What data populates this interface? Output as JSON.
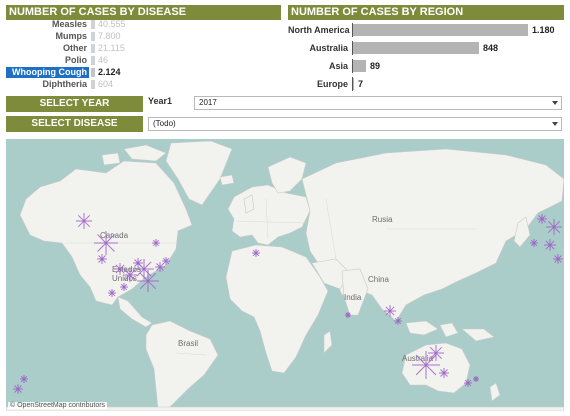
{
  "disease_panel": {
    "title": "NUMBER OF CASES BY DISEASE",
    "items": [
      {
        "label": "Measles",
        "value": "40.555",
        "selected": false
      },
      {
        "label": "Mumps",
        "value": "7.800",
        "selected": false
      },
      {
        "label": "Other",
        "value": "21.115",
        "selected": false
      },
      {
        "label": "Polio",
        "value": "46",
        "selected": false
      },
      {
        "label": "Whooping Cough",
        "value": "2.124",
        "selected": true
      },
      {
        "label": "Diphtheria",
        "value": "604",
        "selected": false
      }
    ]
  },
  "region_panel": {
    "title": "NUMBER OF CASES BY REGION",
    "max_value": 1180,
    "items": [
      {
        "label": "North America",
        "value": 1180,
        "display": "1.180"
      },
      {
        "label": "Australia",
        "value": 848,
        "display": "848"
      },
      {
        "label": "Asia",
        "value": 89,
        "display": "89"
      },
      {
        "label": "Europe",
        "value": 7,
        "display": "7"
      }
    ]
  },
  "filters": {
    "year": {
      "button_label": "SELECT YEAR",
      "caption": "Year1",
      "value": "2017"
    },
    "disease": {
      "button_label": "SELECT DISEASE",
      "value": "(Todo)"
    }
  },
  "map": {
    "labels": {
      "canada": "Canada",
      "usa": "Estados Unidos",
      "russia": "Rusia",
      "china": "China",
      "india": "India",
      "brazil": "Brasil",
      "australia": "Australia"
    },
    "credit": "© OpenStreetMap contributors",
    "colors": {
      "water": "#aacdca",
      "land": "#f2f2ef",
      "marker": "#9b5fc7"
    }
  },
  "colors": {
    "header": "#7d8b3b",
    "selected": "#1f6fc4",
    "bar": "#b4b4b4"
  }
}
